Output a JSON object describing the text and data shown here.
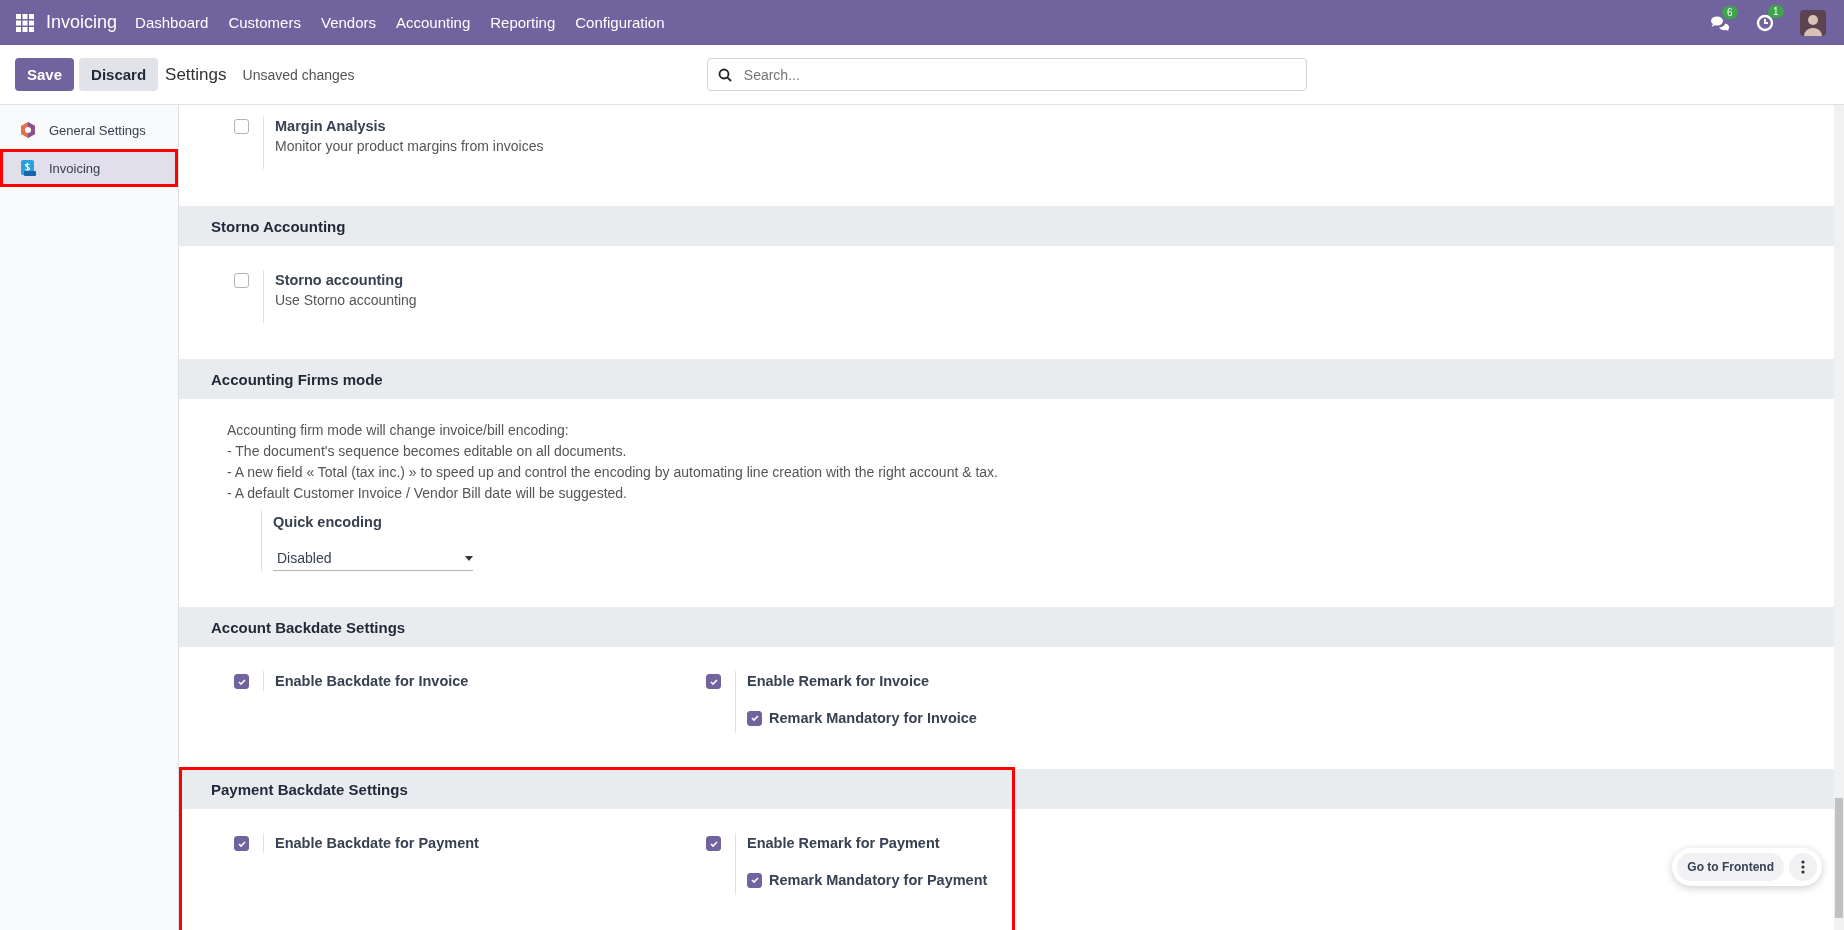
{
  "navbar": {
    "app_name": "Invoicing",
    "menu": [
      "Dashboard",
      "Customers",
      "Vendors",
      "Accounting",
      "Reporting",
      "Configuration"
    ],
    "messages_count": "6",
    "activities_count": "1"
  },
  "control_panel": {
    "buttons": [
      {
        "label": "Save",
        "kind": "primary"
      },
      {
        "label": "Discard",
        "kind": "secondary"
      }
    ],
    "title": "Settings",
    "status": "Unsaved changes",
    "search": {
      "placeholder": "Search..."
    }
  },
  "sidebar": {
    "items": [
      {
        "label": "General Settings",
        "selected": false,
        "highlighted": false
      },
      {
        "label": "Invoicing",
        "selected": true,
        "highlighted": true
      }
    ]
  },
  "sections": [
    {
      "settings": [
        {
          "kind": "checkbox",
          "checked": false,
          "label": "Margin Analysis",
          "description": "Monitor your product margins from invoices"
        }
      ]
    },
    {
      "title": "Storno Accounting",
      "settings": [
        {
          "kind": "checkbox",
          "checked": false,
          "label": "Storno accounting",
          "description": "Use Storno accounting"
        }
      ]
    },
    {
      "title": "Accounting Firms mode",
      "note": [
        "Accounting firm mode will change invoice/bill encoding:",
        "- The document's sequence becomes editable on all documents.",
        "- A new field « Total (tax inc.) » to speed up and control the encoding by automating line creation with the right account & tax.",
        "- A default Customer Invoice / Vendor Bill date will be suggested."
      ],
      "settings": [
        {
          "kind": "select",
          "label": "Quick encoding",
          "value": "Disabled"
        }
      ]
    },
    {
      "title": "Account Backdate Settings",
      "settings": [
        {
          "kind": "checkbox",
          "checked": true,
          "label": "Enable Backdate for Invoice"
        },
        {
          "kind": "checkbox",
          "checked": true,
          "label": "Enable Remark for Invoice",
          "children": [
            {
              "label": "Remark Mandatory for Invoice",
              "checked": true
            }
          ]
        }
      ]
    },
    {
      "title": "Payment Backdate Settings",
      "highlighted": true,
      "settings": [
        {
          "kind": "checkbox",
          "checked": true,
          "label": "Enable Backdate for Payment"
        },
        {
          "kind": "checkbox",
          "checked": true,
          "label": "Enable Remark for Payment",
          "children": [
            {
              "label": "Remark Mandatory for Payment",
              "checked": true
            }
          ]
        }
      ]
    }
  ],
  "floating": {
    "button": "Go to Frontend"
  }
}
